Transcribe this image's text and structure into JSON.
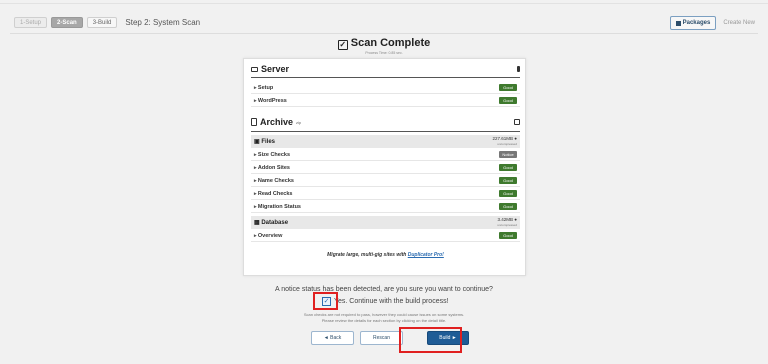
{
  "steps": [
    {
      "label": "1-Setup"
    },
    {
      "label": "2-Scan"
    },
    {
      "label": "3-Build"
    }
  ],
  "step_title": "Step 2: System Scan",
  "header_buttons": {
    "packages": "Packages",
    "create_new": "Create New"
  },
  "scan": {
    "title": "Scan Complete",
    "subtitle": "Process Time: 0.85 sec."
  },
  "server": {
    "title": "Server",
    "rows": [
      {
        "label": "Setup",
        "status": "Good"
      },
      {
        "label": "WordPress",
        "status": "Good"
      }
    ]
  },
  "archive": {
    "title": "Archive",
    "title_sup": "zip",
    "files": {
      "label": "Files",
      "size": "227.61MB",
      "size_note": "uncompressed"
    },
    "file_rows": [
      {
        "label": "Size Checks",
        "status": "Notice"
      },
      {
        "label": "Addon Sites",
        "status": "Good"
      },
      {
        "label": "Name Checks",
        "status": "Good"
      },
      {
        "label": "Read Checks",
        "status": "Good"
      },
      {
        "label": "Migration Status",
        "status": "Good"
      }
    ],
    "database": {
      "label": "Database",
      "size": "3.42MB",
      "size_note": "uncompressed"
    },
    "db_rows": [
      {
        "label": "Overview",
        "status": "Good"
      }
    ]
  },
  "promo": {
    "text": "Migrate large, multi-gig sites with ",
    "link": "Duplicator Pro!"
  },
  "notice_question": "A notice status has been detected, are you sure you want to continue?",
  "confirm_label": "Yes. Continue with the build process!",
  "fine_print": {
    "line1": "Scan checks are not required to pass, however they could cause issues on some systems.",
    "line2": "Please review the details for each section by clicking on the detail title."
  },
  "actions": {
    "back": "◄ Back",
    "rescan": "Rescan",
    "build": "Build ►"
  },
  "colors": {
    "good": "#3f7a2e",
    "notice": "#777777",
    "primary": "#1f5c96",
    "highlight": "#e02020"
  }
}
